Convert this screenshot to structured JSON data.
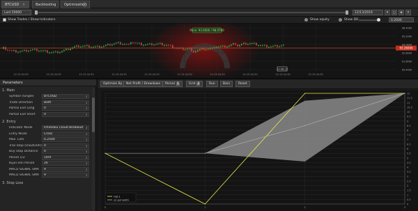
{
  "tabs": [
    {
      "label": "BTCUSD",
      "close": "×"
    },
    {
      "label": "Backtesting",
      "close": ""
    },
    {
      "label": "Optimization",
      "close": ""
    }
  ],
  "toolbar": {
    "symbol_field": "Last 50000",
    "date_value": "12/13/2016",
    "right_value": "12/17/2016"
  },
  "options": {
    "show_trades_label": "Show Trades / Show Indicators",
    "opt_a_label": "Show equity",
    "opt_b_label": "Show DD",
    "opt_c_value": "0.2000"
  },
  "price_chart": {
    "tooltip": "Price: 93.0000 / 98.0700",
    "price_tag": "93.26000",
    "y_labels": [
      "96.4000",
      "95.2000",
      "94.0000",
      "92.8000",
      "91.6000",
      "90.4000"
    ],
    "x_labels": [
      "12:13:44:30",
      "12:13:44:30",
      "12:13:44:30",
      "12:13:44:30",
      "12:13:44:30",
      "12:13:44:30",
      "12:13:44:30",
      "12:13:44:30",
      "12:13:44:30",
      "12:13:44:30"
    ],
    "cursor_label": "13:06:23"
  },
  "params": {
    "header": "Parameters",
    "sections": [
      {
        "title": "1. Main",
        "rows": [
          {
            "label": "Symbol (Single)",
            "value": "BTCUSD"
          },
          {
            "label": "Trade Direction",
            "value": "Both"
          },
          {
            "label": "Partial Exit Long",
            "value": "0"
          },
          {
            "label": "Partial Exit Short",
            "value": "0"
          }
        ]
      },
      {
        "title": "2. Entry",
        "rows": [
          {
            "label": "Indicator Mode",
            "value": "Ichimoku Cloud Breakout"
          },
          {
            "label": "Entry Mode",
            "value": "Cross"
          },
          {
            "label": "Max. Lots",
            "value": "0.2500"
          },
          {
            "label": "Trail Stop (USD/DUR)",
            "value": "0"
          },
          {
            "label": "Buy Stop Distance",
            "value": "0"
          },
          {
            "label": "Period 1/2",
            "value": "14/9"
          },
          {
            "label": "Kijun-sen Period",
            "value": "26"
          },
          {
            "label": "MACD SIGNAL SMA",
            "value": "9"
          },
          {
            "label": "MACD SIGNAL SMA",
            "value": "9"
          }
        ]
      },
      {
        "title": "3. Stop Loss",
        "rows": []
      }
    ]
  },
  "opt_toolbar": {
    "buttons": [
      "Optimize By",
      "Net Profit / Drawdown",
      "Period",
      "Grid",
      "Run",
      "Bars",
      "Reset"
    ],
    "badge_a": "1",
    "badge_b": "2"
  },
  "chart_data": {
    "type": "line",
    "x": [
      0,
      1,
      2,
      3
    ],
    "xlim": [
      0,
      3
    ],
    "ylim": [
      0,
      12
    ],
    "y_ticks": [
      12,
      11.5,
      11,
      10.5,
      10,
      9.5,
      9,
      8.5,
      8,
      7.5,
      7,
      6.5,
      6,
      5.5,
      5,
      4.5,
      4,
      3.5,
      3,
      2.5,
      2,
      1.5,
      1,
      0.5,
      0
    ],
    "y_tick_labels": [
      "12",
      "11.5",
      "11",
      "10.5",
      "10",
      "9.5",
      "9",
      "8.5",
      "8",
      "7.5",
      "7",
      "6.5",
      "6",
      "5.5",
      "5",
      "4.5",
      "4",
      "3.5",
      "3",
      "2.5",
      "2",
      "1.5",
      "1",
      "0.5",
      "0"
    ],
    "x_tick_labels": [
      "0",
      "1",
      "2",
      "3"
    ],
    "series": [
      {
        "name": "Opt.1",
        "values": [
          5.5,
          0,
          12,
          12
        ],
        "color": "#e8e84a"
      },
      {
        "name": "x2 opt width",
        "values": [
          5.5,
          5.5,
          8.5,
          12
        ],
        "color": "#bbbbbb"
      }
    ],
    "band": {
      "upper": [
        5.5,
        5.5,
        11.2,
        12
      ],
      "lower": [
        5.5,
        5.5,
        4.6,
        12
      ]
    },
    "grid": true,
    "legend": "bottom-left"
  }
}
